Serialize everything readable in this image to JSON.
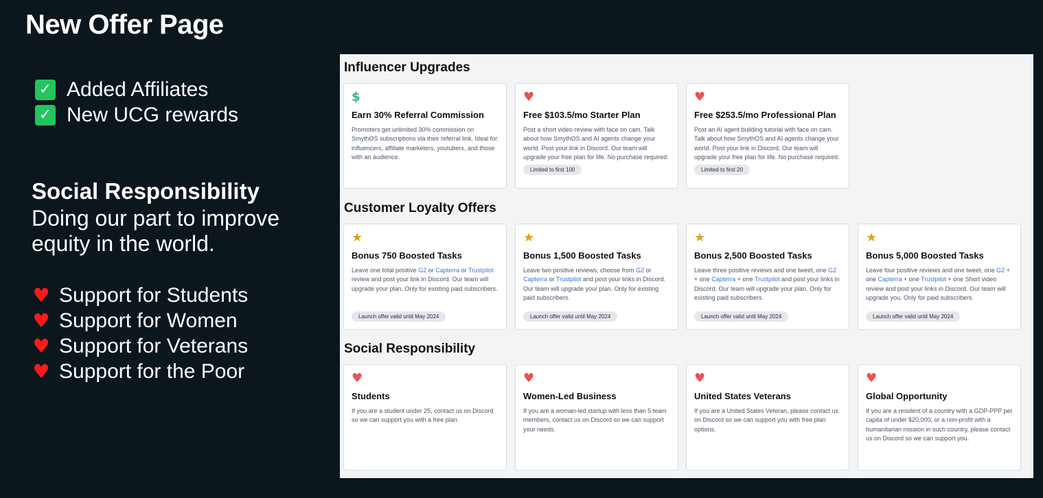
{
  "title": "New Offer Page",
  "checks": [
    {
      "label": "Added Affiliates"
    },
    {
      "label": "New UCG rewards"
    }
  ],
  "social": {
    "heading": "Social Responsibility",
    "subtitle": "Doing our part to improve equity in the world."
  },
  "supports": [
    {
      "label": "Support for Students"
    },
    {
      "label": "Support for Women"
    },
    {
      "label": "Support for Veterans"
    },
    {
      "label": "Support for the Poor"
    }
  ],
  "panel": {
    "influencer": {
      "title": "Influencer Upgrades",
      "cards": [
        {
          "icon": "dollar-icon",
          "title": "Earn 30% Referral Commission",
          "desc": "Promoters get unlimited 30% commission on SmythOS subscriptions via their referral link. Ideal for influencers, affiliate marketers, youtubers, and those with an audience.",
          "badge": ""
        },
        {
          "icon": "heart-icon",
          "title": "Free $103.5/mo Starter Plan",
          "desc": "Post a short video review with face on cam. Talk about how SmythOS and AI agents change your world. Post your link in Discord. Our team will upgrade your free plan for life. No purchase required.",
          "badge": "Limited to first 100"
        },
        {
          "icon": "heart-icon",
          "title": "Free $253.5/mo Professional Plan",
          "desc": "Post an AI agent building tutorial with face on cam. Talk about how SmythOS and AI agents change your world. Post your link in Discord. Our team will upgrade your free plan for life. No purchase required.",
          "badge": "Limited to first 20"
        }
      ]
    },
    "loyalty": {
      "title": "Customer Loyalty Offers",
      "cards": [
        {
          "icon": "star-icon",
          "title": "Bonus 750 Boosted Tasks",
          "d1": "Leave one total positive ",
          "l1": "G2",
          "d2": " or ",
          "l2": "Capterra",
          "d3": " or ",
          "l3": "Trustpilot",
          "d4": " review and post your link in Discord. Our team will upgrade your plan. Only for existing paid subscribers.",
          "badge": "Launch offer valid until May 2024"
        },
        {
          "icon": "star-icon",
          "title": "Bonus 1,500 Boosted Tasks",
          "d1": "Leave two positive reviews, choose from ",
          "l1": "G2",
          "d2": " or ",
          "l2": "Capterra",
          "d3": " or ",
          "l3": "Trustpilot",
          "d4": " and post your links in Discord. Our team will upgrade your plan. Only for existing paid subscribers.",
          "badge": "Launch offer valid until May 2024"
        },
        {
          "icon": "star-icon",
          "title": "Bonus 2,500 Boosted Tasks",
          "d1": "Leave three positive reviews and one tweet, one ",
          "l1": "G2",
          "d2": " + one ",
          "l2": "Capterra",
          "d3": " + one ",
          "l3": "Trustpilot",
          "d4": " and post your links in Discord. Our team will upgrade your plan. Only for existing paid subscribers.",
          "badge": "Launch offer valid until May 2024"
        },
        {
          "icon": "star-icon",
          "title": "Bonus 5,000 Boosted Tasks",
          "d1": "Leave four positive reviews and one tweet, one ",
          "l1": "G2",
          "d2": " + one ",
          "l2": "Capterra",
          "d3": " + one ",
          "l3": "Trustpilot",
          "d4": " + one Short video review and post your links in Discord. Our team will upgrade you. Only for paid subscribers.",
          "badge": "Launch offer valid until May 2024"
        }
      ]
    },
    "social": {
      "title": "Social Responsibility",
      "cards": [
        {
          "icon": "heart-icon",
          "title": "Students",
          "desc": "If you are a student under 25, contact us on Discord so we can support you with a free plan."
        },
        {
          "icon": "heart-icon",
          "title": "Women-Led Business",
          "desc": "If you are a woman-led startup with less than 5 team members, contact us on Discord so we can support your needs."
        },
        {
          "icon": "heart-icon",
          "title": "United States Veterans",
          "desc": "If you are a United States Veteran, please contact us on Discord so we can support you with free plan options."
        },
        {
          "icon": "heart-icon",
          "title": "Global Opportunity",
          "desc": "If you are a resident of a country with a GDP-PPP per capita of under $20,000, or a non-profit with a humanitarian mission in such country, please contact us on Discord so we can support you."
        }
      ]
    }
  }
}
